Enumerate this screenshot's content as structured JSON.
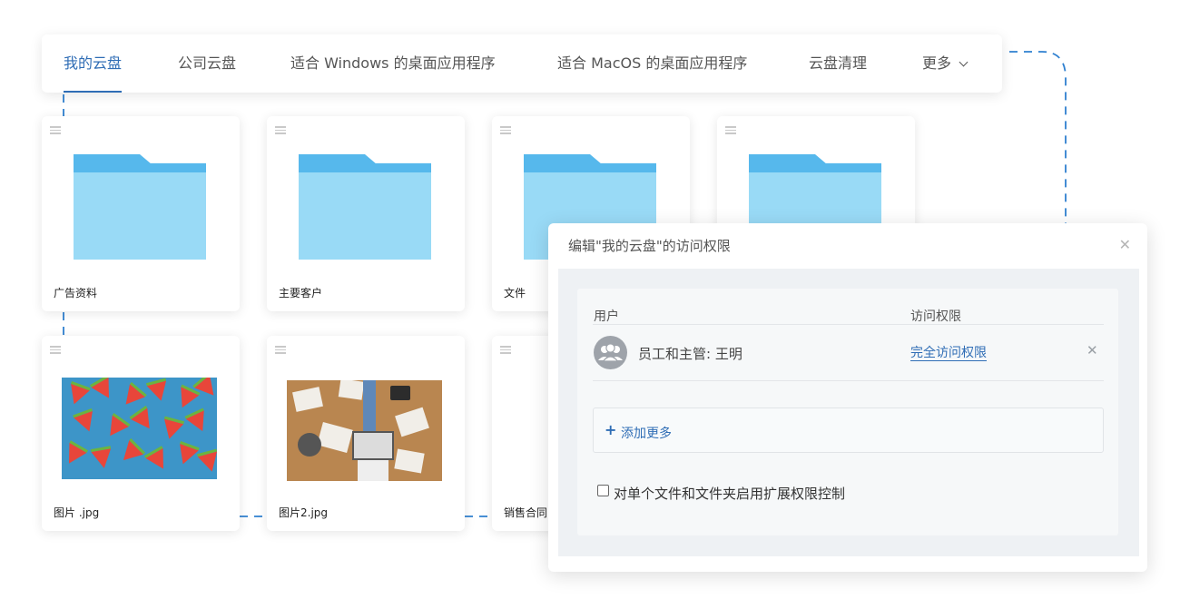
{
  "tabs": [
    {
      "label": "我的云盘",
      "active": true
    },
    {
      "label": "公司云盘"
    },
    {
      "label": "适合 Windows 的桌面应用程序"
    },
    {
      "label": "适合 MacOS 的桌面应用程序"
    },
    {
      "label": "云盘清理"
    },
    {
      "label": "更多"
    }
  ],
  "cards": [
    {
      "label": "广告资料",
      "type": "folder"
    },
    {
      "label": "主要客户",
      "type": "folder"
    },
    {
      "label": "文件",
      "type": "folder"
    },
    {
      "label": "",
      "type": "folder"
    },
    {
      "label": "图片 .jpg",
      "type": "image"
    },
    {
      "label": "图片2.jpg",
      "type": "image"
    },
    {
      "label": "销售合同",
      "type": "document"
    }
  ],
  "dialog": {
    "title": "编辑\"我的云盘\"的访问权限",
    "columns": {
      "user": "用户",
      "permission": "访问权限"
    },
    "entry": {
      "user": "员工和主管: 王明",
      "permission": "完全访问权限"
    },
    "add_more": "添加更多",
    "extended_permissions": {
      "label": "对单个文件和文件夹启用扩展权限控制",
      "checked": false
    }
  },
  "colors": {
    "accent": "#2f6db5",
    "folder_tab": "#56b8ec",
    "folder_body": "#99daf6"
  },
  "icons": {
    "close": "close-icon",
    "remove": "remove-icon",
    "more": "chevron-down-icon",
    "avatar": "users-group-icon",
    "drag": "drag-handle-icon"
  }
}
